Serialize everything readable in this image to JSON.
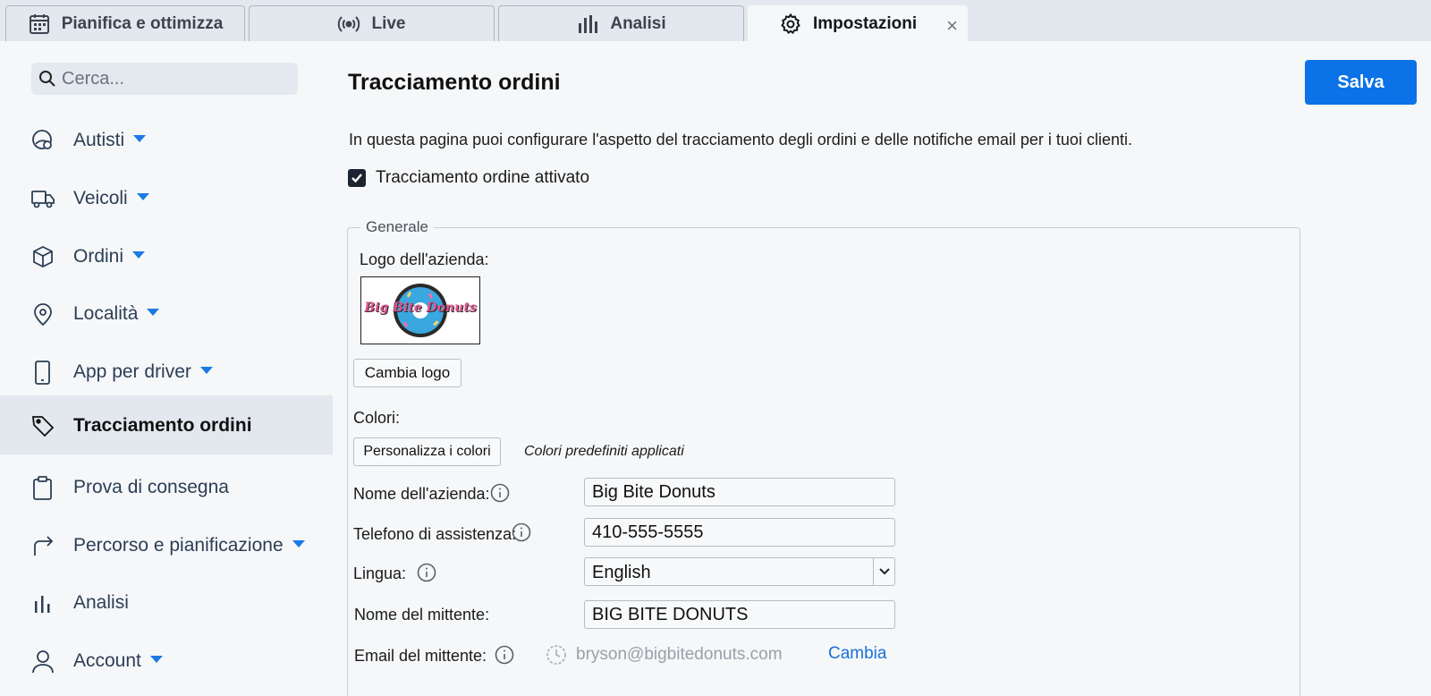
{
  "tabs": [
    {
      "label": "Pianifica e ottimizza",
      "icon": "calendar-icon"
    },
    {
      "label": "Live",
      "icon": "broadcast-icon"
    },
    {
      "label": "Analisi",
      "icon": "bar-chart-icon"
    },
    {
      "label": "Impostazioni",
      "icon": "gear-icon",
      "active": true,
      "close": "×"
    }
  ],
  "search": {
    "placeholder": "Cerca..."
  },
  "sidebar": {
    "items": [
      {
        "label": "Autisti",
        "icon": "driver-icon",
        "dropdown": true
      },
      {
        "label": "Veicoli",
        "icon": "truck-icon",
        "dropdown": true
      },
      {
        "label": "Ordini",
        "icon": "box-icon",
        "dropdown": true
      },
      {
        "label": "Località",
        "icon": "map-pin-icon",
        "dropdown": true
      },
      {
        "label": "App per driver",
        "icon": "phone-icon",
        "dropdown": true
      },
      {
        "label": "Tracciamento ordini",
        "icon": "tag-icon",
        "active": true
      },
      {
        "label": "Prova di consegna",
        "icon": "clipboard-icon"
      },
      {
        "label": "Percorso e pianificazione",
        "icon": "route-arrow-icon",
        "dropdown": true
      },
      {
        "label": "Analisi",
        "icon": "bar-chart-icon"
      },
      {
        "label": "Account",
        "icon": "user-icon",
        "dropdown": true
      }
    ]
  },
  "main": {
    "title": "Tracciamento ordini",
    "save_label": "Salva",
    "intro": "In questa pagina puoi configurare l'aspetto del tracciamento degli ordini e delle notifiche email per i tuoi clienti.",
    "enable_label": "Tracciamento ordine attivato",
    "enable_checked": true,
    "general": {
      "legend": "Generale",
      "logo_label": "Logo dell'azienda:",
      "logo_text": "Big Bite Donuts",
      "change_logo": "Cambia logo",
      "colors_label": "Colori:",
      "customize_colors": "Personalizza i colori",
      "colors_note": "Colori predefiniti applicati",
      "company_label": "Nome dell'azienda:",
      "company_value": "Big Bite Donuts",
      "phone_label": "Telefono di assistenza:",
      "phone_value": "410-555-5555",
      "language_label": "Lingua:",
      "language_value": "English",
      "sender_name_label": "Nome del mittente:",
      "sender_name_value": "BIG BITE DONUTS",
      "sender_email_label": "Email del mittente:",
      "sender_email_value": "bryson@bigbitedonuts.com",
      "change_link": "Cambia"
    }
  },
  "colors": {
    "accent": "#0b72e7",
    "link": "#1b6fd9",
    "caret": "#1b7ae4"
  }
}
